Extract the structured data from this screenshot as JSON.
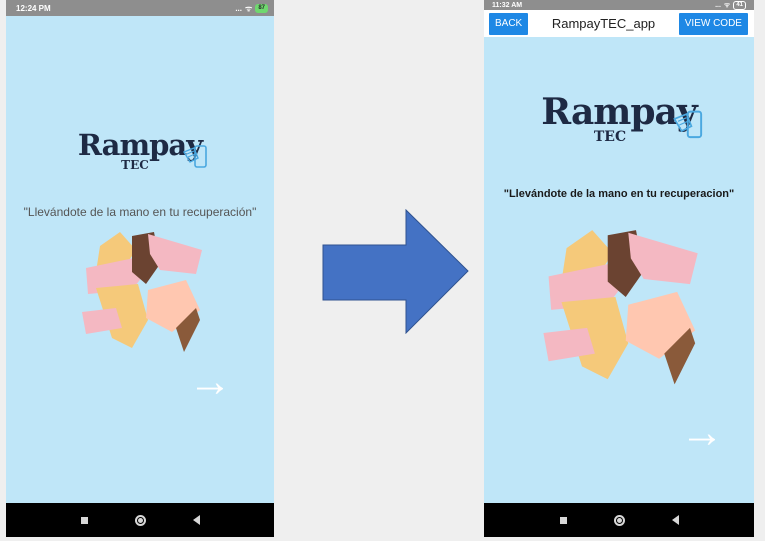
{
  "left_phone": {
    "status": {
      "time": "12:24 PM",
      "signal_text": "...",
      "battery": "87"
    },
    "logo": {
      "word": "Rampay",
      "sub": "TEC"
    },
    "tagline": "\"Llevándote de la mano en tu recuperación\"",
    "next_arrow": "→"
  },
  "right_phone": {
    "status": {
      "time": "11:32 AM",
      "signal_text": "...",
      "battery": "41"
    },
    "appbar": {
      "back_label": "BACK",
      "title": "RampayTEC_app",
      "view_code_label": "VIEW CODE"
    },
    "logo": {
      "word": "Rampay",
      "sub": "TEC"
    },
    "tagline": "\"Llevándote de la mano en tu recuperacion\"",
    "next_arrow": "→"
  },
  "colors": {
    "screen_bg": "#bfe6f8",
    "app_button": "#1e88e5",
    "transition_arrow": "#4472c4",
    "logo_text": "#1e2a44"
  },
  "icons": [
    "phone-logo-icon",
    "handshake-illustration",
    "next-arrow-icon",
    "transition-arrow"
  ]
}
